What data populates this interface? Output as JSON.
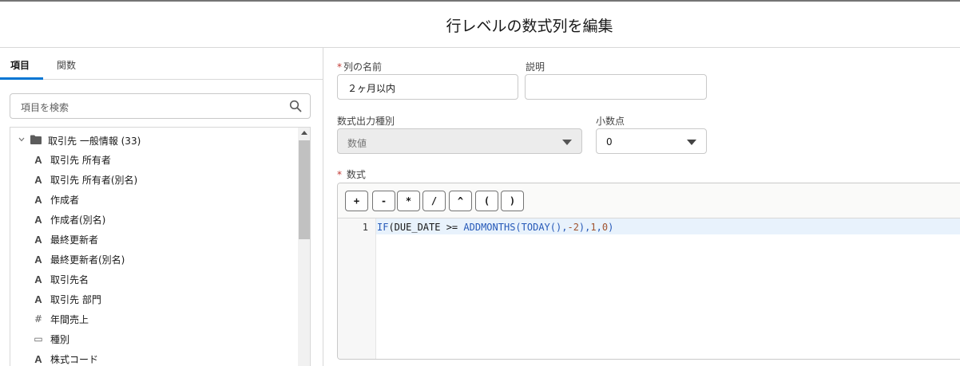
{
  "header": {
    "title": "行レベルの数式列を編集"
  },
  "left": {
    "tabs": [
      {
        "label": "項目",
        "active": true
      },
      {
        "label": "関数",
        "active": false
      }
    ],
    "search": {
      "placeholder": "項目を検索",
      "icon": "search-icon"
    },
    "tree": {
      "folder": {
        "label": "取引先 一般情報 (33)",
        "icon": "folder-icon",
        "expanded": true
      },
      "items": [
        {
          "label": "取引先 所有者",
          "type_icon": "A"
        },
        {
          "label": "取引先 所有者(別名)",
          "type_icon": "A"
        },
        {
          "label": "作成者",
          "type_icon": "A"
        },
        {
          "label": "作成者(別名)",
          "type_icon": "A"
        },
        {
          "label": "最終更新者",
          "type_icon": "A"
        },
        {
          "label": "最終更新者(別名)",
          "type_icon": "A"
        },
        {
          "label": "取引先名",
          "type_icon": "A"
        },
        {
          "label": "取引先 部門",
          "type_icon": "A"
        },
        {
          "label": "年間売上",
          "type_icon": "#"
        },
        {
          "label": "種別",
          "type_icon": "▭"
        },
        {
          "label": "株式コード",
          "type_icon": "A"
        }
      ]
    }
  },
  "form": {
    "column_name": {
      "label": "列の名前",
      "required_mark": "*",
      "value": "２ヶ月以内"
    },
    "description": {
      "label": "説明",
      "value": ""
    },
    "output_type": {
      "label": "数式出力種別",
      "value": "数値",
      "disabled": true
    },
    "decimals": {
      "label": "小数点",
      "value": "0"
    },
    "formula": {
      "label": "数式",
      "required_mark": "*",
      "operators": [
        "+",
        "-",
        "*",
        "/",
        "^",
        "(",
        ")"
      ],
      "line_number": "1",
      "code_tokens": [
        {
          "t": "IF",
          "k": "fn"
        },
        {
          "t": "(DUE_DATE ",
          "k": "id"
        },
        {
          "t": ">=",
          "k": "op"
        },
        {
          "t": " ",
          "k": "id"
        },
        {
          "t": "ADDMONTHS",
          "k": "fn"
        },
        {
          "t": "(",
          "k": "fn"
        },
        {
          "t": "TODAY",
          "k": "fn"
        },
        {
          "t": "(),",
          "k": "fn"
        },
        {
          "t": "-2",
          "k": "num"
        },
        {
          "t": "),",
          "k": "fn"
        },
        {
          "t": "1",
          "k": "num"
        },
        {
          "t": ",",
          "k": "fn"
        },
        {
          "t": "0",
          "k": "num"
        },
        {
          "t": ")",
          "k": "fn"
        }
      ]
    }
  },
  "colors": {
    "accent": "#0176d3",
    "required": "#c23934",
    "function": "#2659b8",
    "number": "#a0522d"
  }
}
